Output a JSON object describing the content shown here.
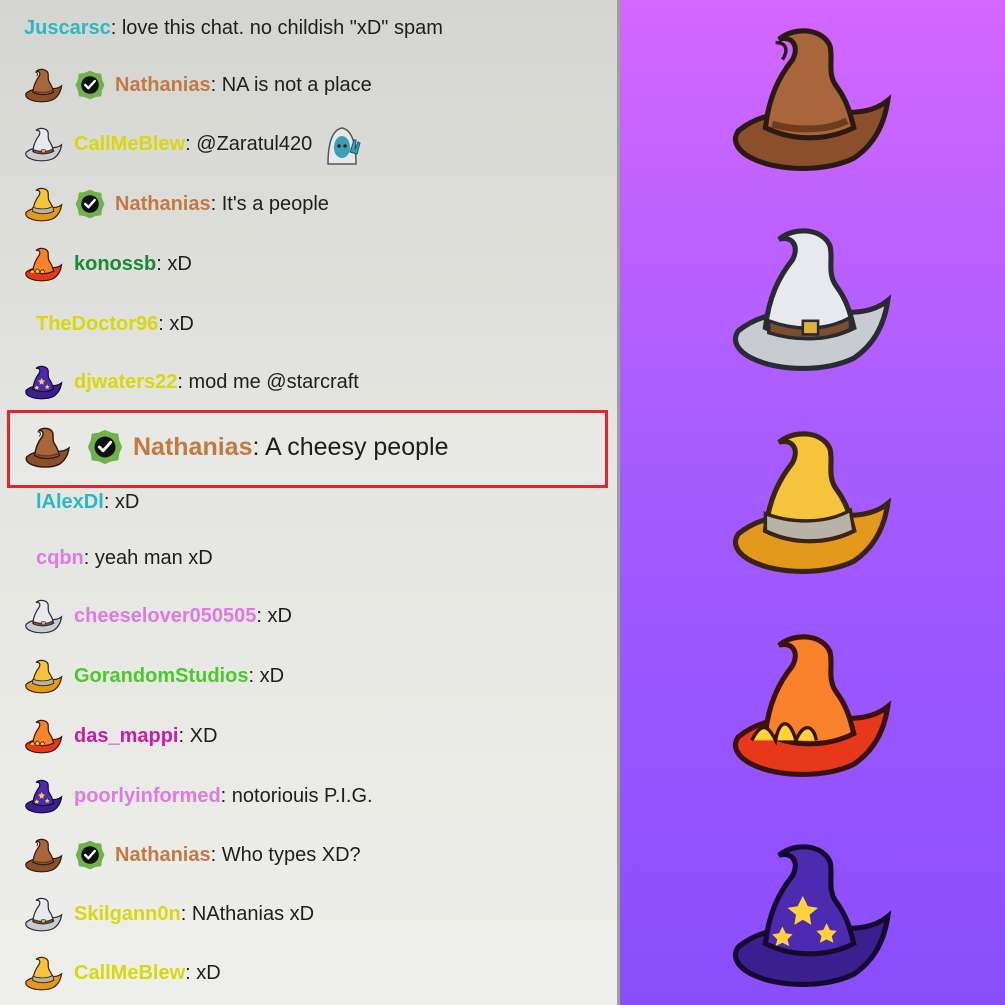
{
  "colors": {
    "highlight_border": "#e0262e",
    "side_panel_top": "#d467ff",
    "side_panel_bottom": "#8a4dfc"
  },
  "messages": [
    {
      "badge_hat": "none",
      "mod": false,
      "user": "Juscarsc",
      "user_color": "#2bb7c6",
      "text": ": love this chat. no childish \"xD\" spam"
    },
    {
      "badge_hat": "brown-wizard-hat-icon",
      "mod": true,
      "user": "Nathanias",
      "user_color": "#c27a44",
      "text": ": NA is not a place"
    },
    {
      "badge_hat": "white-wizard-hat-icon",
      "mod": false,
      "user": "CallMeBlew",
      "user_color": "#d8d80c",
      "text": ": @Zaratul420",
      "emote": "wave-emote-icon"
    },
    {
      "badge_hat": "gold-wizard-hat-icon",
      "mod": true,
      "user": "Nathanias",
      "user_color": "#c27a44",
      "text": ": It's a people"
    },
    {
      "badge_hat": "fire-wizard-hat-icon",
      "mod": false,
      "user": "konossb",
      "user_color": "#1a8a35",
      "text": ": xD"
    },
    {
      "badge_hat": "none",
      "mod": false,
      "user": "TheDoctor96",
      "user_color": "#d8d80c",
      "text": ": xD"
    },
    {
      "badge_hat": "purple-wizard-hat-icon",
      "mod": false,
      "user": "djwaters22",
      "user_color": "#d8d80c",
      "text": ": mod me @starcraft"
    },
    {
      "badge_hat": "brown-wizard-hat-icon",
      "mod": true,
      "user": "Nathanias",
      "user_color": "#c27a44",
      "text": ": A cheesy people",
      "highlighted": true
    },
    {
      "badge_hat": "none",
      "mod": false,
      "user": "lAlexDl",
      "user_color": "#2bb7c6",
      "text": ": xD"
    },
    {
      "badge_hat": "none",
      "mod": false,
      "user": "cqbn",
      "user_color": "#dd7be0",
      "text": ": yeah man xD"
    },
    {
      "badge_hat": "white-wizard-hat-icon",
      "mod": false,
      "user": "cheeselover050505",
      "user_color": "#dd7be0",
      "text": ": xD"
    },
    {
      "badge_hat": "gold-wizard-hat-icon",
      "mod": false,
      "user": "GorandomStudios",
      "user_color": "#4bc92c",
      "text": ": xD"
    },
    {
      "badge_hat": "fire-wizard-hat-icon",
      "mod": false,
      "user": "das_mappi",
      "user_color": "#cc1ba8",
      "text": ": XD"
    },
    {
      "badge_hat": "purple-wizard-hat-icon",
      "mod": false,
      "user": "poorlyinformed",
      "user_color": "#dd7be0",
      "text": ": notoriouis P.I.G."
    },
    {
      "badge_hat": "brown-wizard-hat-icon",
      "mod": true,
      "user": "Nathanias",
      "user_color": "#c27a44",
      "text": ": Who types XD?"
    },
    {
      "badge_hat": "white-wizard-hat-icon",
      "mod": false,
      "user": "Skilgann0n",
      "user_color": "#d8d80c",
      "text": ": NAthanias xD"
    },
    {
      "badge_hat": "gold-wizard-hat-icon",
      "mod": false,
      "user": "CallMeBlew",
      "user_color": "#d8d80c",
      "text": ": xD"
    }
  ],
  "badge_showcase": [
    "brown-wizard-hat-icon",
    "white-wizard-hat-icon",
    "gold-wizard-hat-icon",
    "fire-wizard-hat-icon",
    "purple-wizard-hat-icon"
  ]
}
